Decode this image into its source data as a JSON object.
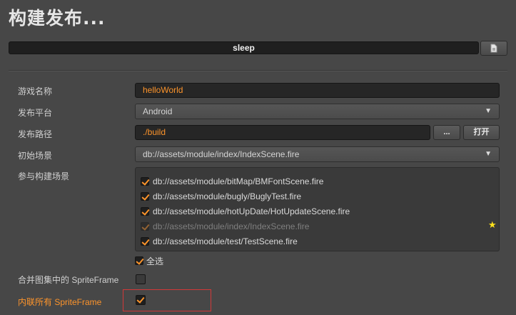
{
  "header": {
    "title": "构建发布..."
  },
  "progress": {
    "text": "sleep"
  },
  "log_button": {
    "icon": "document-icon"
  },
  "fields": {
    "game_name": {
      "label": "游戏名称",
      "value": "helloWorld"
    },
    "platform": {
      "label": "发布平台",
      "selected": "Android"
    },
    "build_path": {
      "label": "发布路径",
      "value": "./build",
      "browse_label": "...",
      "open_label": "打开"
    },
    "start_scene": {
      "label": "初始场景",
      "selected": "db://assets/module/index/IndexScene.fire"
    },
    "scenes": {
      "label": "参与构建场景",
      "items": [
        {
          "path": "db://assets/module/bitMap/BMFontScene.fire",
          "checked": true,
          "disabled": false
        },
        {
          "path": "db://assets/module/bugly/BuglyTest.fire",
          "checked": true,
          "disabled": false
        },
        {
          "path": "db://assets/module/hotUpDate/HotUpdateScene.fire",
          "checked": true,
          "disabled": false
        },
        {
          "path": "db://assets/module/index/IndexScene.fire",
          "checked": true,
          "disabled": true
        },
        {
          "path": "db://assets/module/test/TestScene.fire",
          "checked": true,
          "disabled": false
        }
      ],
      "select_all_label": "全选"
    },
    "merge_spriteframe": {
      "label": "合并图集中的 SpriteFrame",
      "checked": false
    },
    "inline_spriteframe": {
      "label": "内联所有 SpriteFrame",
      "checked": true
    }
  },
  "colors": {
    "accent": "#fd942b",
    "background": "#474747",
    "highlight_box": "#d23838",
    "start_scene_star": "#ffe21c"
  }
}
